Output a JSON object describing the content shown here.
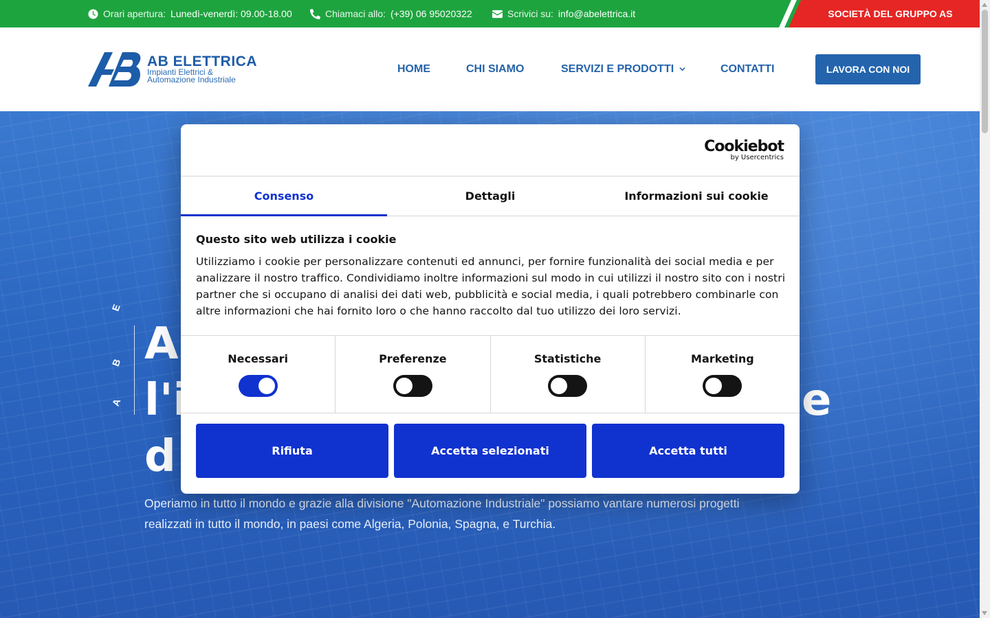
{
  "topbar": {
    "hours_label": "Orari apertura:",
    "hours_value": "Lunedì-venerdì: 09.00-18.00",
    "phone_label": "Chiamaci allo:",
    "phone_value": "(+39) 06 95020322",
    "email_label": "Scrivici su:",
    "email_value": "info@abelettrica.it",
    "group_label": "SOCIETÀ DEL GRUPPO AS"
  },
  "header": {
    "logo": {
      "title": "AB ELETTRICA",
      "subtitle_line1": "Impianti Elettrici &",
      "subtitle_line2": "Automazione Industriale"
    },
    "nav": [
      {
        "label": "HOME"
      },
      {
        "label": "CHI SIAMO"
      },
      {
        "label": "SERVIZI E PRODOTTI"
      },
      {
        "label": "CONTATTI"
      }
    ],
    "cta_label": "LAVORA CON NOI"
  },
  "hero": {
    "vertical_letters": [
      "E",
      "B",
      "A"
    ],
    "title_line1": "A",
    "title_line2": "l'i",
    "title_line2_tail": "e",
    "title_line3": "d",
    "text": "Operiamo in tutto il mondo e grazie alla divisione \"Automazione Industriale\" possiamo vantare numerosi progetti realizzati in tutto il mondo, in paesi come Algeria, Polonia, Spagna, e Turchia."
  },
  "cookie_dialog": {
    "brand_main": "Cookiebot",
    "brand_sub": "by Usercentrics",
    "tabs": [
      {
        "label": "Consenso",
        "active": true
      },
      {
        "label": "Dettagli",
        "active": false
      },
      {
        "label": "Informazioni sui cookie",
        "active": false
      }
    ],
    "heading": "Questo sito web utilizza i cookie",
    "body": "Utilizziamo i cookie per personalizzare contenuti ed annunci, per fornire funzionalità dei social media e per analizzare il nostro traffico. Condividiamo inoltre informazioni sul modo in cui utilizzi il nostro sito con i nostri partner che si occupano di analisi dei dati web, pubblicità e social media, i quali potrebbero combinarle con altre informazioni che hai fornito loro o che hanno raccolto dal tuo utilizzo dei loro servizi.",
    "toggles": [
      {
        "label": "Necessari",
        "checked": true
      },
      {
        "label": "Preferenze",
        "checked": false
      },
      {
        "label": "Statistiche",
        "checked": false
      },
      {
        "label": "Marketing",
        "checked": false
      }
    ],
    "buttons": [
      {
        "label": "Rifiuta"
      },
      {
        "label": "Accetta selezionati"
      },
      {
        "label": "Accetta tutti"
      }
    ]
  },
  "colors": {
    "topbar_green": "#1ea43f",
    "group_red": "#e52624",
    "brand_blue": "#2464ad",
    "cookiebot_blue": "#1032cf"
  }
}
